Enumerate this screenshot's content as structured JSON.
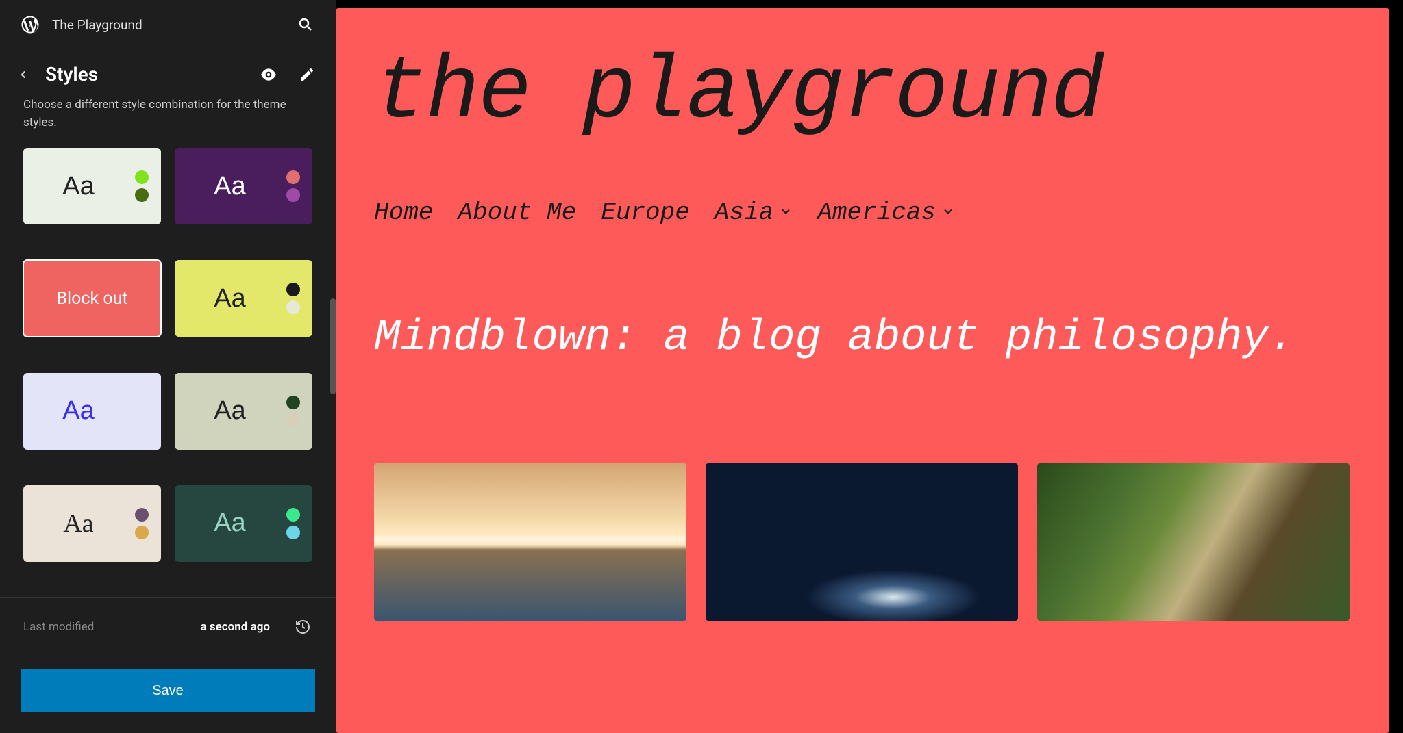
{
  "topbar": {
    "site_name": "The Playground"
  },
  "panel": {
    "title": "Styles",
    "description": "Choose a different style combination for the theme styles."
  },
  "style_cards": [
    {
      "sample": "Aa",
      "bg": "#eaf0e6",
      "text": "#222",
      "dot1": "#7fe51a",
      "dot2": "#4a6b11"
    },
    {
      "sample": "Aa",
      "bg": "#4a1e5c",
      "text": "#fff",
      "dot1": "#e07070",
      "dot2": "#a04aa8"
    },
    {
      "label": "Block out",
      "bg": "#ef6461",
      "selected": true
    },
    {
      "sample": "Aa",
      "bg": "#e3e86b",
      "text": "#222",
      "dot1": "#1a1a1a",
      "dot2": "#e8e8d8"
    },
    {
      "sample": "Aa",
      "bg": "#e4e4f8",
      "text": "#3a2ef0",
      "dot1": null,
      "dot2": null
    },
    {
      "sample": "Aa",
      "bg": "#d0d4bc",
      "text": "#222",
      "dot1": "#1f4420",
      "dot2": "#d6d0b8"
    },
    {
      "sample": "Aa",
      "bg": "#ebe3d8",
      "text": "#222",
      "dot1": "#6a5070",
      "dot2": "#d9a84a",
      "serif": true
    },
    {
      "sample": "Aa",
      "bg": "#264640",
      "text": "#9ad4c0",
      "dot1": "#3be88f",
      "dot2": "#6dd5e8"
    }
  ],
  "footer": {
    "label": "Last modified",
    "value": "a second ago"
  },
  "save_button": "Save",
  "preview": {
    "site_title": "the playground",
    "nav": [
      {
        "label": "Home",
        "has_submenu": false
      },
      {
        "label": "About Me",
        "has_submenu": false
      },
      {
        "label": "Europe",
        "has_submenu": false
      },
      {
        "label": "Asia",
        "has_submenu": true
      },
      {
        "label": "Americas",
        "has_submenu": true
      }
    ],
    "tagline": "Mindblown: a blog about philosophy."
  }
}
